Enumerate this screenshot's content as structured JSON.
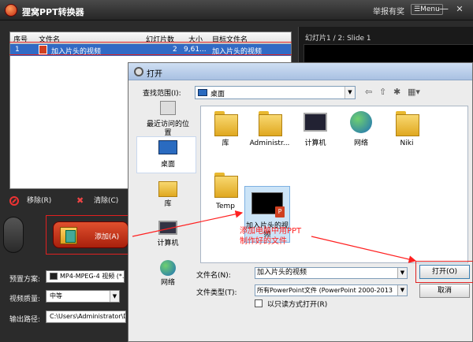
{
  "app": {
    "title": "狸窝PPT转换器",
    "report_link": "举报有奖",
    "menu_label": "Menu",
    "minimize_glyph": "—",
    "close_glyph": "✕"
  },
  "file_table": {
    "columns": [
      "序号",
      "文件名",
      "幻灯片数",
      "大小",
      "目标文件名"
    ],
    "rows": [
      {
        "index": "1",
        "name": "加入片头的视频",
        "slides": "2",
        "size": "9,61...",
        "target": "加入片头的视频"
      }
    ]
  },
  "preview": {
    "slide_label": "幻灯片1 / 2: Slide 1"
  },
  "actions": {
    "remove_label": "移除(R)",
    "clear_label": "清除(C)",
    "add_label": "添加(A)"
  },
  "settings": {
    "preset_label": "预置方案:",
    "preset_value": "MP4-MPEG-4 视频 (*.m",
    "quality_label": "视频质量:",
    "quality_value": "中等",
    "output_label": "输出路径:",
    "output_value": "C:\\Users\\Administrator\\Des"
  },
  "dialog": {
    "title": "打开",
    "look_in_label": "查找范围(I):",
    "look_in_value": "桌面",
    "places": [
      {
        "label": "最近访问的位置"
      },
      {
        "label": "桌面"
      },
      {
        "label": "库"
      },
      {
        "label": "计算机"
      },
      {
        "label": "网络"
      }
    ],
    "items": [
      {
        "label": "库"
      },
      {
        "label": "Administr..."
      },
      {
        "label": "计算机"
      },
      {
        "label": "网络"
      },
      {
        "label": "Niki"
      },
      {
        "label": "Temp"
      },
      {
        "label": "加入片头的视频"
      }
    ],
    "annotation_line1": "添加电脑中用PPT",
    "annotation_line2": "制作好的文件",
    "filename_label": "文件名(N):",
    "filename_value": "加入片头的视频",
    "filetype_label": "文件类型(T):",
    "filetype_value": "所有PowerPoint文件 (PowerPoint 2000-2013",
    "readonly_label": "以只读方式打开(R)",
    "open_label": "打开(O)",
    "cancel_label": "取消"
  },
  "colors": {
    "annotation_red": "#ff2020",
    "selection_blue": "#316ac5",
    "add_button_red": "#c8361a"
  }
}
